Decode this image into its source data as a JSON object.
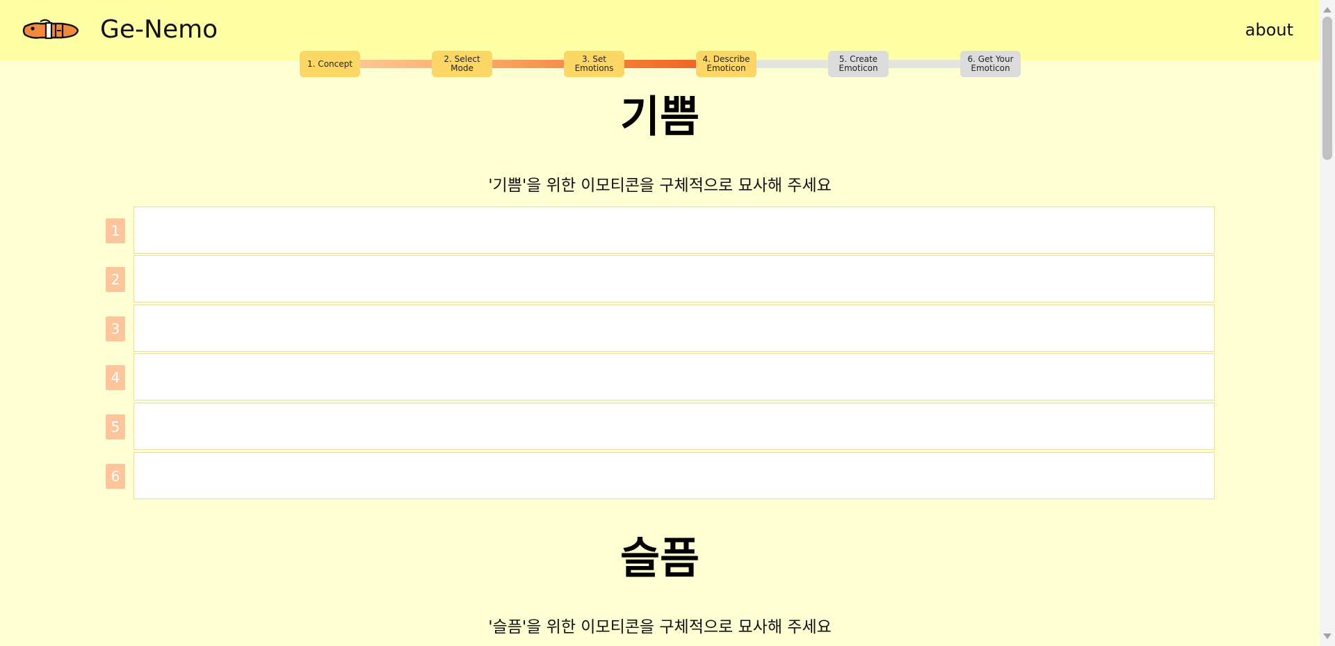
{
  "header": {
    "brand": "Ge-Nemo",
    "about_label": "about",
    "background": "#ffffa6"
  },
  "stepper": {
    "steps": [
      {
        "label": "1. Concept",
        "state": "done"
      },
      {
        "label": "2. Select Mode",
        "state": "done"
      },
      {
        "label": "3. Set\nEmotions",
        "state": "done"
      },
      {
        "label": "4. Describe\nEmoticon",
        "state": "current"
      },
      {
        "label": "5. Create\nEmoticon",
        "state": "todo"
      },
      {
        "label": "6. Get Your\nEmoticon",
        "state": "todo"
      }
    ],
    "colors": {
      "step_done": "#fdd766",
      "step_todo": "#dcdcdc",
      "line_todo": "#e4e4e0"
    }
  },
  "sections": [
    {
      "emotion": "기쁨",
      "prompt": "'기쁨'을 위한 이모티콘을 구체적으로 묘사해 주세요",
      "rows": [
        {
          "number": "1",
          "value": ""
        },
        {
          "number": "2",
          "value": ""
        },
        {
          "number": "3",
          "value": ""
        },
        {
          "number": "4",
          "value": ""
        },
        {
          "number": "5",
          "value": ""
        },
        {
          "number": "6",
          "value": ""
        }
      ]
    },
    {
      "emotion": "슬픔",
      "prompt": "'슬픔'을 위한 이모티콘을 구체적으로 묘사해 주세요",
      "rows": []
    }
  ],
  "colors": {
    "page_background": "#ffffd4",
    "row_number_badge": "#fdc59c",
    "input_border": "#e9dca5"
  },
  "icons": {
    "logo": "fish-logo-icon"
  }
}
